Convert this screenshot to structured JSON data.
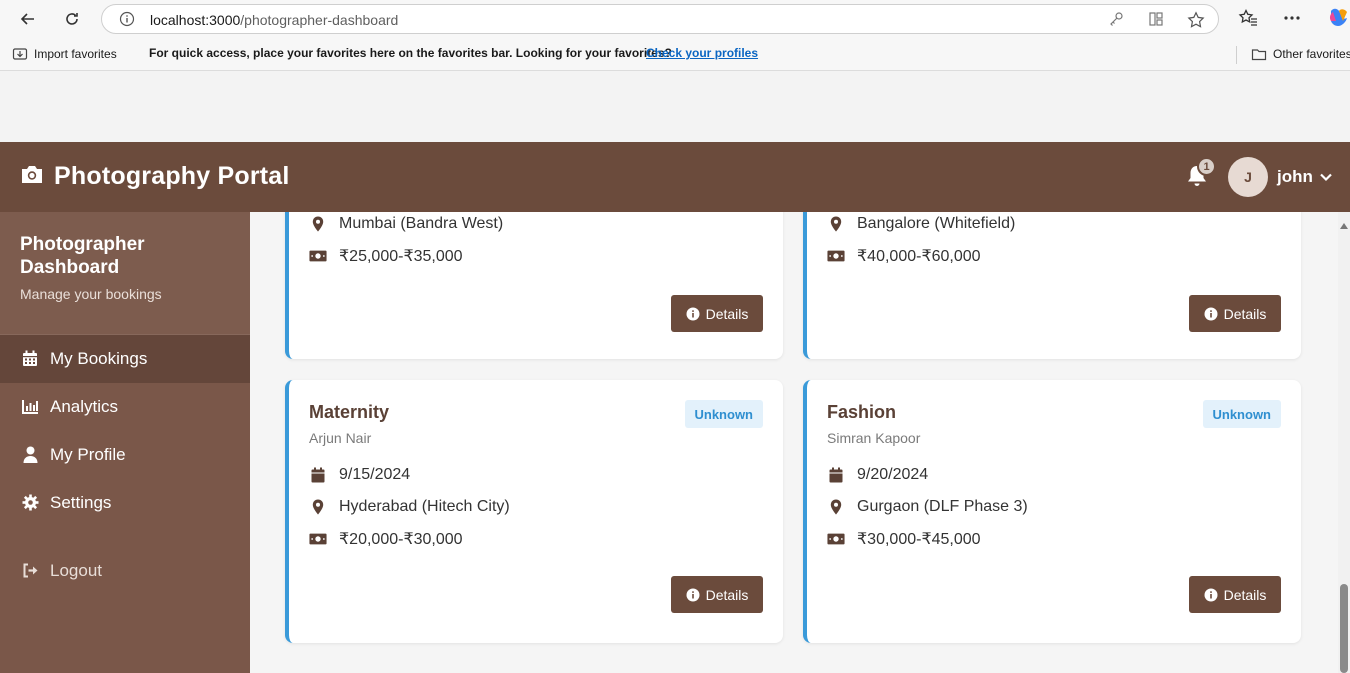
{
  "browser": {
    "url_host": "localhost:3000",
    "url_path": "/photographer-dashboard",
    "favorites": {
      "import_label": "Import favorites",
      "message": "For quick access, place your favorites here on the favorites bar. Looking for your favorites?",
      "link_label": "Check your profiles",
      "other_label": "Other favorites"
    }
  },
  "header": {
    "title": "Photography Portal",
    "notification_count": "1",
    "avatar_initial": "J",
    "username": "john"
  },
  "sidebar": {
    "title": "Photographer Dashboard",
    "subtitle": "Manage your bookings",
    "items": [
      {
        "label": "My Bookings",
        "icon": "calendar-icon"
      },
      {
        "label": "Analytics",
        "icon": "chart-bar-icon"
      },
      {
        "label": "My Profile",
        "icon": "user-icon"
      },
      {
        "label": "Settings",
        "icon": "gear-icon"
      }
    ],
    "logout_label": "Logout"
  },
  "bookings": [
    {
      "location": "Mumbai (Bandra West)",
      "price": "₹25,000-₹35,000",
      "details_label": "Details"
    },
    {
      "location": "Bangalore (Whitefield)",
      "price": "₹40,000-₹60,000",
      "details_label": "Details"
    },
    {
      "title": "Maternity",
      "client": "Arjun Nair",
      "status": "Unknown",
      "date": "9/15/2024",
      "location": "Hyderabad (Hitech City)",
      "price": "₹20,000-₹30,000",
      "details_label": "Details"
    },
    {
      "title": "Fashion",
      "client": "Simran Kapoor",
      "status": "Unknown",
      "date": "9/20/2024",
      "location": "Gurgaon (DLF Phase 3)",
      "price": "₹30,000-₹45,000",
      "details_label": "Details"
    }
  ],
  "colors": {
    "brand": "#6b4b3c",
    "sidebar": "#7a5749",
    "accent": "#3a9ad9"
  }
}
